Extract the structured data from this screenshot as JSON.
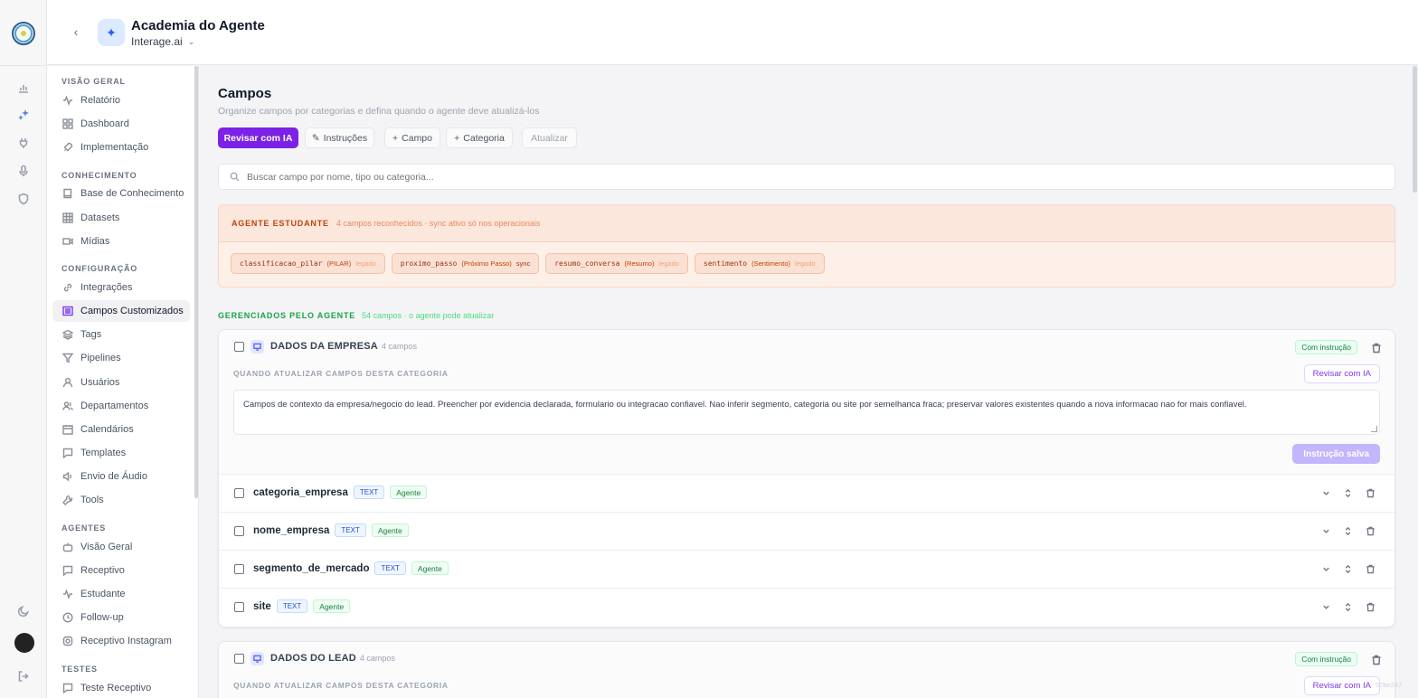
{
  "rail": {
    "icons": [
      "chart-icon",
      "sparkle-icon",
      "plug-icon",
      "mic-icon",
      "shield-icon",
      "moon-icon",
      "logout-icon"
    ]
  },
  "header": {
    "title": "Academia do Agente",
    "org": "Interage.ai"
  },
  "sidebar": {
    "sections": [
      {
        "title": "VISÃO GERAL",
        "items": [
          "Relatório",
          "Dashboard",
          "Implementação"
        ]
      },
      {
        "title": "CONHECIMENTO",
        "items": [
          "Base de Conhecimento",
          "Datasets",
          "Mídias"
        ]
      },
      {
        "title": "CONFIGURAÇÃO",
        "items": [
          "Integrações",
          "Campos Customizados",
          "Tags",
          "Pipelines",
          "Usuários",
          "Departamentos",
          "Calendários",
          "Templates",
          "Envio de Áudio",
          "Tools"
        ]
      },
      {
        "title": "AGENTES",
        "items": [
          "Visão Geral",
          "Receptivo",
          "Estudante",
          "Follow-up",
          "Receptivo Instagram"
        ]
      },
      {
        "title": "TESTES",
        "items": [
          "Teste Receptivo"
        ]
      }
    ],
    "active_item": "Campos Customizados"
  },
  "page": {
    "title": "Campos",
    "subtitle": "Organize campos por categorias e defina quando o agente deve atualizá-los"
  },
  "toolbar": {
    "revisar": "Revisar com IA",
    "instrucoes": "Instruções",
    "campo": "Campo",
    "categoria": "Categoria",
    "atualizar": "Atualizar"
  },
  "search": {
    "placeholder": "Buscar campo por nome, tipo ou categoria..."
  },
  "student": {
    "title": "AGENTE ESTUDANTE",
    "note": "4 campos reconhecidos · sync ativo só nos operacionais",
    "chips": [
      {
        "name": "classificacao_pilar",
        "label": "(PILAR)",
        "status": "legado"
      },
      {
        "name": "proximo_passo",
        "label": "(Próximo Passo)",
        "status": "sync"
      },
      {
        "name": "resumo_conversa",
        "label": "(Resumo)",
        "status": "legado"
      },
      {
        "name": "sentimento",
        "label": "(Sentimento)",
        "status": "legado"
      }
    ]
  },
  "managed": {
    "title": "GERENCIADOS PELO AGENTE",
    "note": "54 campos · o agente pode atualizar"
  },
  "categories": [
    {
      "name": "DADOS DA EMPRESA",
      "count": "4 campos",
      "badge": "Com instrução",
      "when_label": "QUANDO ATUALIZAR CAMPOS DESTA CATEGORIA",
      "revisar": "Revisar com IA",
      "instruction": "Campos de contexto da empresa/negocio do lead. Preencher por evidencia declarada, formulario ou integracao confiavel. Nao inferir segmento, categoria ou site por semelhanca fraca; preservar valores existentes quando a nova informacao nao for mais confiavel.",
      "saved": "Instrução salva",
      "fields": [
        {
          "name": "categoria_empresa",
          "type": "TEXT",
          "source": "Agente"
        },
        {
          "name": "nome_empresa",
          "type": "TEXT",
          "source": "Agente"
        },
        {
          "name": "segmento_de_mercado",
          "type": "TEXT",
          "source": "Agente"
        },
        {
          "name": "site",
          "type": "TEXT",
          "source": "Agente"
        }
      ]
    },
    {
      "name": "DADOS DO LEAD",
      "count": "4 campos",
      "badge": "Com instrução",
      "when_label": "QUANDO ATUALIZAR CAMPOS DESTA CATEGORIA",
      "revisar": "Revisar com IA"
    }
  ],
  "watermark": "57be247"
}
